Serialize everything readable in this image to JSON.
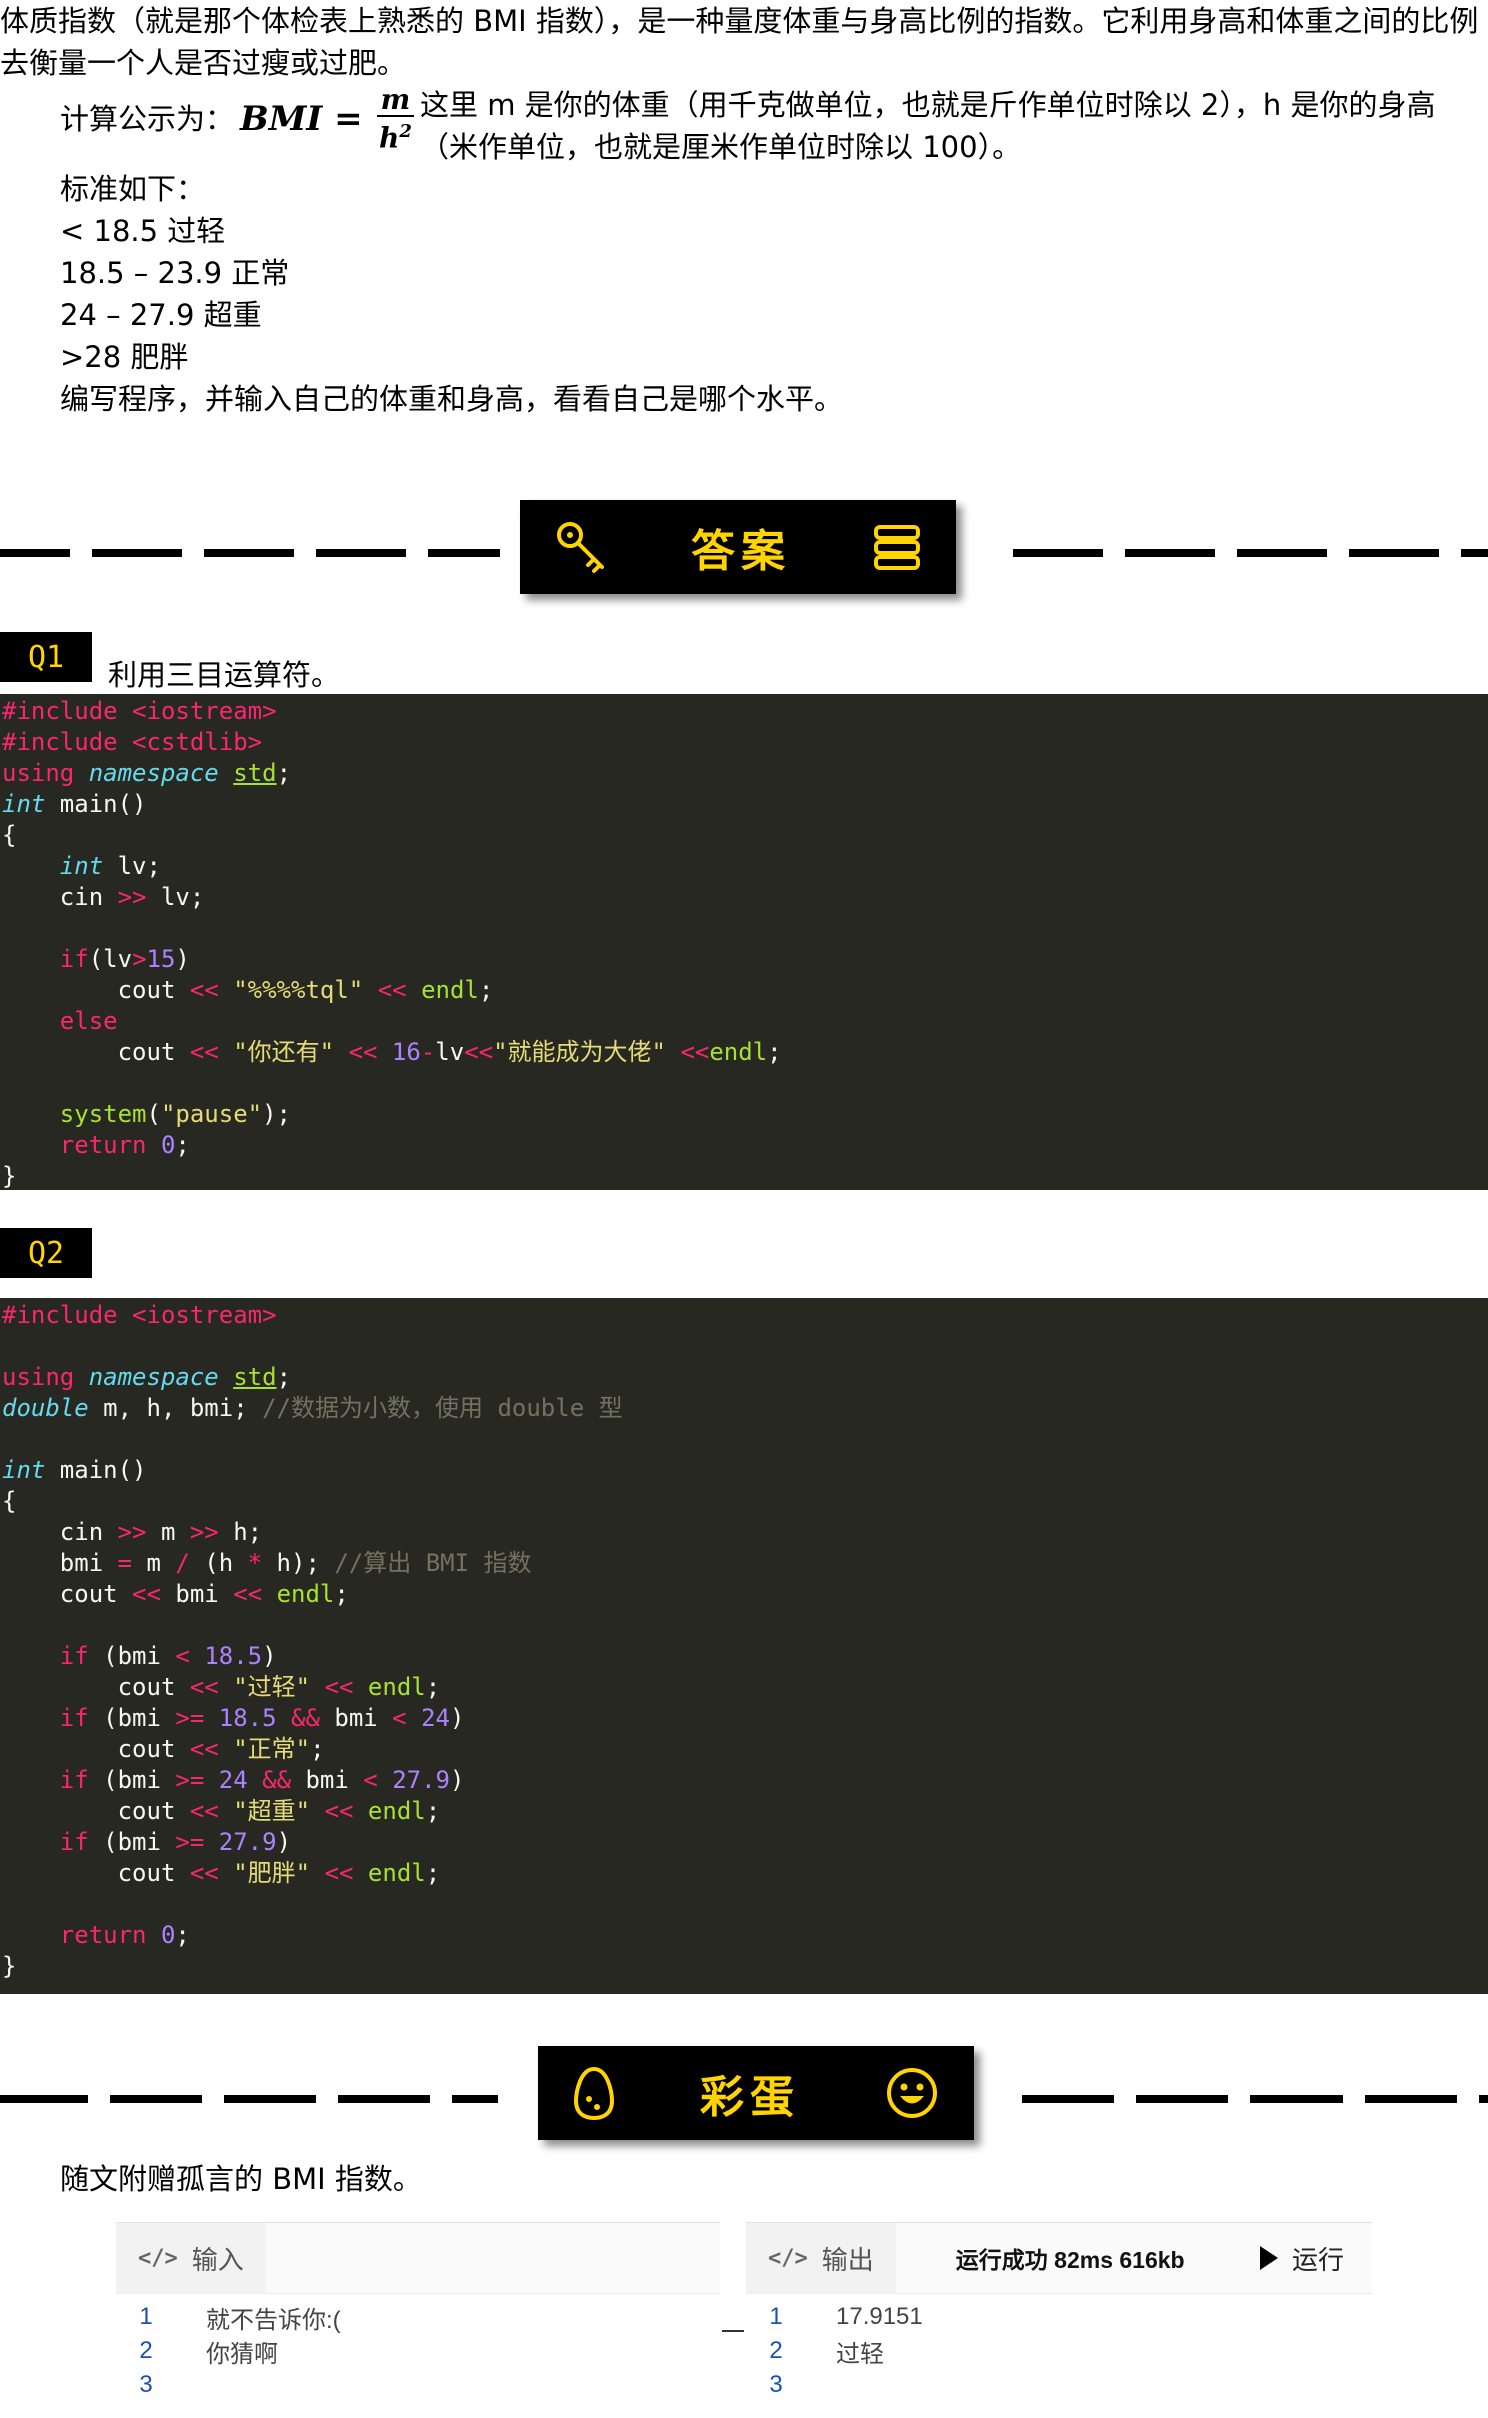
{
  "intro": {
    "p1": "体质指数（就是那个体检表上熟悉的 BMI 指数），是一种量度体重与身高比例的指数。它利用身高和体重之间的比例去衡量一个人是否过瘦或过肥。",
    "formula_prefix": "计算公示为：",
    "formula_lhs": "BMI =",
    "formula_num": "m",
    "formula_den": "h",
    "formula_den_exp": "2",
    "formula_suffix": "这里 m 是你的体重（用千克做单位，也就是斤作单位时除以 2），h 是你的身高（米作单位，也就是厘米作单位时除以 100）。",
    "standard_title": "标准如下：",
    "standards": [
      "< 18.5  过轻",
      "18.5 – 23.9  正常",
      "24 – 27.9  超重",
      ">28  肥胖"
    ],
    "task": "编写程序，并输入自己的体重和身高，看看自己是哪个水平。"
  },
  "answer_banner": {
    "title": "答案",
    "left_icon": "key-icon",
    "right_icon": "stack-icon"
  },
  "q1": {
    "tag": "Q1",
    "text": "利用三目运算符。",
    "code": [
      [
        [
          "kw",
          "#include "
        ],
        [
          "kw",
          "<iostream>"
        ]
      ],
      [
        [
          "kw",
          "#include "
        ],
        [
          "kw",
          "<cstdlib>"
        ]
      ],
      [
        [
          "kw",
          "using "
        ],
        [
          "ty",
          "namespace "
        ],
        [
          "ns",
          "std"
        ],
        [
          "",
          "; "
        ]
      ],
      [
        [
          "ty",
          "int "
        ],
        [
          "",
          "main()"
        ]
      ],
      [
        [
          "",
          "{"
        ]
      ],
      [
        [
          "",
          "    "
        ],
        [
          "ty",
          "int "
        ],
        [
          "",
          "lv;"
        ]
      ],
      [
        [
          "",
          "    cin "
        ],
        [
          "op",
          ">>"
        ],
        [
          "",
          " lv;"
        ]
      ],
      [
        [
          "",
          ""
        ]
      ],
      [
        [
          "",
          "    "
        ],
        [
          "kw",
          "if"
        ],
        [
          "",
          "(lv"
        ],
        [
          "op",
          ">"
        ],
        [
          "nu",
          "15"
        ],
        [
          "",
          ")"
        ]
      ],
      [
        [
          "",
          "        cout "
        ],
        [
          "op",
          "<<"
        ],
        [
          "",
          " "
        ],
        [
          "st",
          "\"%%%%tql\""
        ],
        [
          "",
          " "
        ],
        [
          "op",
          "<<"
        ],
        [
          "",
          " "
        ],
        [
          "fn",
          "endl"
        ],
        [
          "",
          ";"
        ]
      ],
      [
        [
          "",
          "    "
        ],
        [
          "kw",
          "else"
        ]
      ],
      [
        [
          "",
          "        cout "
        ],
        [
          "op",
          "<<"
        ],
        [
          "",
          " "
        ],
        [
          "st",
          "\"你还有\""
        ],
        [
          "",
          " "
        ],
        [
          "op",
          "<<"
        ],
        [
          "",
          " "
        ],
        [
          "nu",
          "16"
        ],
        [
          "op",
          "-"
        ],
        [
          "",
          "lv"
        ],
        [
          "op",
          "<<"
        ],
        [
          "st",
          "\"就能成为大佬\""
        ],
        [
          "",
          " "
        ],
        [
          "op",
          "<<"
        ],
        [
          "fn",
          "endl"
        ],
        [
          "",
          ";"
        ]
      ],
      [
        [
          "",
          ""
        ]
      ],
      [
        [
          "",
          "    "
        ],
        [
          "fn",
          "system"
        ],
        [
          "",
          "("
        ],
        [
          "st",
          "\"pause\""
        ],
        [
          "",
          ");"
        ]
      ],
      [
        [
          "",
          "    "
        ],
        [
          "kw",
          "return "
        ],
        [
          "nu",
          "0"
        ],
        [
          "",
          ";"
        ]
      ],
      [
        [
          "",
          "}"
        ]
      ]
    ]
  },
  "q2": {
    "tag": "Q2",
    "code": [
      [
        [
          "kw",
          "#include "
        ],
        [
          "kw",
          "<iostream>"
        ]
      ],
      [
        [
          "",
          ""
        ]
      ],
      [
        [
          "kw",
          "using "
        ],
        [
          "ty",
          "namespace "
        ],
        [
          "ns",
          "std"
        ],
        [
          "",
          ";"
        ]
      ],
      [
        [
          "ty",
          "double "
        ],
        [
          "",
          "m, h, bmi; "
        ],
        [
          "cm",
          "//数据为小数，使用 double 型"
        ]
      ],
      [
        [
          "",
          ""
        ]
      ],
      [
        [
          "ty",
          "int "
        ],
        [
          "",
          "main()"
        ]
      ],
      [
        [
          "",
          "{"
        ]
      ],
      [
        [
          "",
          "    cin "
        ],
        [
          "op",
          ">>"
        ],
        [
          "",
          " m "
        ],
        [
          "op",
          ">>"
        ],
        [
          "",
          " h;"
        ]
      ],
      [
        [
          "",
          "    bmi "
        ],
        [
          "op",
          "="
        ],
        [
          "",
          " m "
        ],
        [
          "op",
          "/"
        ],
        [
          "",
          " (h "
        ],
        [
          "op",
          "*"
        ],
        [
          "",
          " h); "
        ],
        [
          "cm",
          "//算出 BMI 指数"
        ]
      ],
      [
        [
          "",
          "    cout "
        ],
        [
          "op",
          "<<"
        ],
        [
          "",
          " bmi "
        ],
        [
          "op",
          "<<"
        ],
        [
          "",
          " "
        ],
        [
          "fn",
          "endl"
        ],
        [
          "",
          ";"
        ]
      ],
      [
        [
          "",
          ""
        ]
      ],
      [
        [
          "",
          "    "
        ],
        [
          "kw",
          "if"
        ],
        [
          "",
          " (bmi "
        ],
        [
          "op",
          "<"
        ],
        [
          "",
          " "
        ],
        [
          "nu",
          "18.5"
        ],
        [
          "",
          ")"
        ]
      ],
      [
        [
          "",
          "        cout "
        ],
        [
          "op",
          "<<"
        ],
        [
          "",
          " "
        ],
        [
          "st",
          "\"过轻\""
        ],
        [
          "",
          " "
        ],
        [
          "op",
          "<<"
        ],
        [
          "",
          " "
        ],
        [
          "fn",
          "endl"
        ],
        [
          "",
          ";"
        ]
      ],
      [
        [
          "",
          "    "
        ],
        [
          "kw",
          "if"
        ],
        [
          "",
          " (bmi "
        ],
        [
          "op",
          ">="
        ],
        [
          "",
          " "
        ],
        [
          "nu",
          "18.5"
        ],
        [
          "",
          " "
        ],
        [
          "op",
          "&&"
        ],
        [
          "",
          " bmi "
        ],
        [
          "op",
          "<"
        ],
        [
          "",
          " "
        ],
        [
          "nu",
          "24"
        ],
        [
          "",
          ")"
        ]
      ],
      [
        [
          "",
          "        cout "
        ],
        [
          "op",
          "<<"
        ],
        [
          "",
          " "
        ],
        [
          "st",
          "\"正常\""
        ],
        [
          "",
          ";"
        ]
      ],
      [
        [
          "",
          "    "
        ],
        [
          "kw",
          "if"
        ],
        [
          "",
          " (bmi "
        ],
        [
          "op",
          ">="
        ],
        [
          "",
          " "
        ],
        [
          "nu",
          "24"
        ],
        [
          "",
          " "
        ],
        [
          "op",
          "&&"
        ],
        [
          "",
          " bmi "
        ],
        [
          "op",
          "<"
        ],
        [
          "",
          " "
        ],
        [
          "nu",
          "27.9"
        ],
        [
          "",
          ")"
        ]
      ],
      [
        [
          "",
          "        cout "
        ],
        [
          "op",
          "<<"
        ],
        [
          "",
          " "
        ],
        [
          "st",
          "\"超重\""
        ],
        [
          "",
          " "
        ],
        [
          "op",
          "<<"
        ],
        [
          "",
          " "
        ],
        [
          "fn",
          "endl"
        ],
        [
          "",
          ";"
        ]
      ],
      [
        [
          "",
          "    "
        ],
        [
          "kw",
          "if"
        ],
        [
          "",
          " (bmi "
        ],
        [
          "op",
          ">="
        ],
        [
          "",
          " "
        ],
        [
          "nu",
          "27.9"
        ],
        [
          "",
          ")"
        ]
      ],
      [
        [
          "",
          "        cout "
        ],
        [
          "op",
          "<<"
        ],
        [
          "",
          " "
        ],
        [
          "st",
          "\"肥胖\""
        ],
        [
          "",
          " "
        ],
        [
          "op",
          "<<"
        ],
        [
          "",
          " "
        ],
        [
          "fn",
          "endl"
        ],
        [
          "",
          ";"
        ]
      ],
      [
        [
          "",
          ""
        ]
      ],
      [
        [
          "",
          "    "
        ],
        [
          "kw",
          "return "
        ],
        [
          "nu",
          "0"
        ],
        [
          "",
          ";"
        ]
      ],
      [
        [
          "",
          "}"
        ]
      ]
    ]
  },
  "egg_banner": {
    "title": "彩蛋",
    "left_icon": "egg-icon",
    "right_icon": "smiley-icon"
  },
  "egg": {
    "text": "随文附赠孤言的 BMI 指数。",
    "input_tab": "输入",
    "output_tab": "输出",
    "status": "运行成功 82ms 616kb",
    "run_label": "运行",
    "input_lines": [
      {
        "n": "1",
        "v": "就不告诉你:("
      },
      {
        "n": "2",
        "v": "你猜啊"
      },
      {
        "n": "3",
        "v": ""
      }
    ],
    "output_lines": [
      {
        "n": "1",
        "v": "17.9151"
      },
      {
        "n": "2",
        "v": "过轻"
      },
      {
        "n": "3",
        "v": ""
      }
    ]
  }
}
